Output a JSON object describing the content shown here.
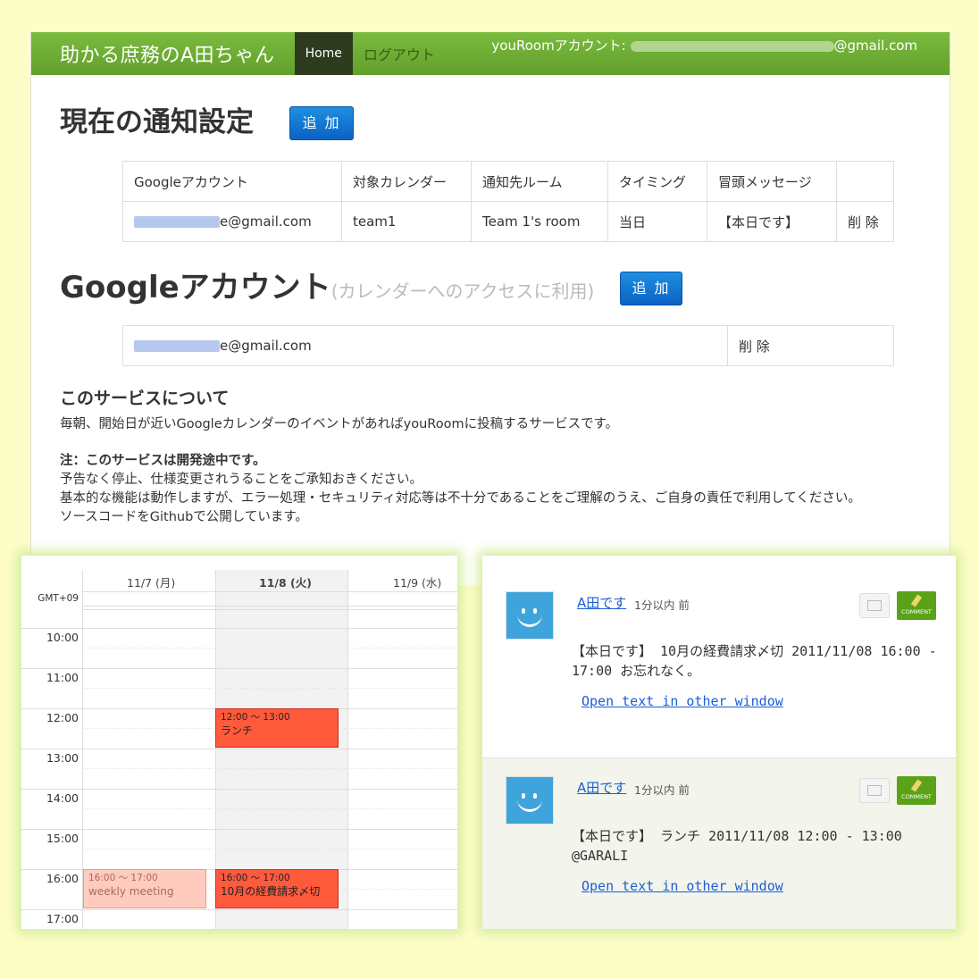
{
  "nav": {
    "brand": "助かる庶務のA田ちゃん",
    "home": "Home",
    "logout": "ログアウト",
    "account_label": "youRoomアカウント:",
    "account_email_suffix": "@gmail.com"
  },
  "notify": {
    "title": "現在の通知設定",
    "add": "追 加",
    "headers": [
      "Googleアカウント",
      "対象カレンダー",
      "通知先ルーム",
      "タイミング",
      "冒頭メッセージ",
      ""
    ],
    "row": {
      "account_suffix": "e@gmail.com",
      "calendar": "team1",
      "room": "Team 1's room",
      "timing": "当日",
      "message": "【本日です】",
      "delete": "削 除"
    }
  },
  "google": {
    "title": "Googleアカウント",
    "subtitle": "(カレンダーへのアクセスに利用)",
    "add": "追 加",
    "row": {
      "account_suffix": "e@gmail.com",
      "delete": "削 除"
    }
  },
  "about": {
    "title": "このサービスについて",
    "desc": "毎朝、開始日が近いGoogleカレンダーのイベントがあればyouRoomに投稿するサービスです。",
    "note_title": "注：このサービスは開発途中です。",
    "note_1": "予告なく停止、仕様変更されうることをご承知おきください。",
    "note_2": "基本的な機能は動作しますが、エラー処理・セキュリティ対応等は不十分であることをご理解のうえ、ご自身の責任で利用してください。",
    "note_3": "ソースコードをGithubで公開しています。"
  },
  "calendar": {
    "tz": "GMT+09",
    "days": [
      "11/7 (月)",
      "11/8 (火)",
      "11/9 (水)"
    ],
    "times": [
      "10:00",
      "11:00",
      "12:00",
      "13:00",
      "14:00",
      "15:00",
      "16:00",
      "17:00"
    ],
    "events": [
      {
        "time": "12:00 ～ 13:00",
        "title": "ランチ"
      },
      {
        "time": "16:00 ～ 17:00",
        "title": "weekly meeting"
      },
      {
        "time": "16:00 ～ 17:00",
        "title": "10月の経費請求〆切"
      }
    ]
  },
  "stream": {
    "posts": [
      {
        "author": "A田です",
        "time": "1分以内 前",
        "text": "【本日です】 10月の経費請求〆切 2011/11/08 16:00 - 17:00 お忘れなく。",
        "link": "Open text in other window",
        "comment": "COMMENT"
      },
      {
        "author": "A田です",
        "time": "1分以内 前",
        "text": "【本日です】 ランチ 2011/11/08 12:00 - 13:00 @GARALI",
        "link": "Open text in other window",
        "comment": "COMMENT"
      }
    ]
  }
}
